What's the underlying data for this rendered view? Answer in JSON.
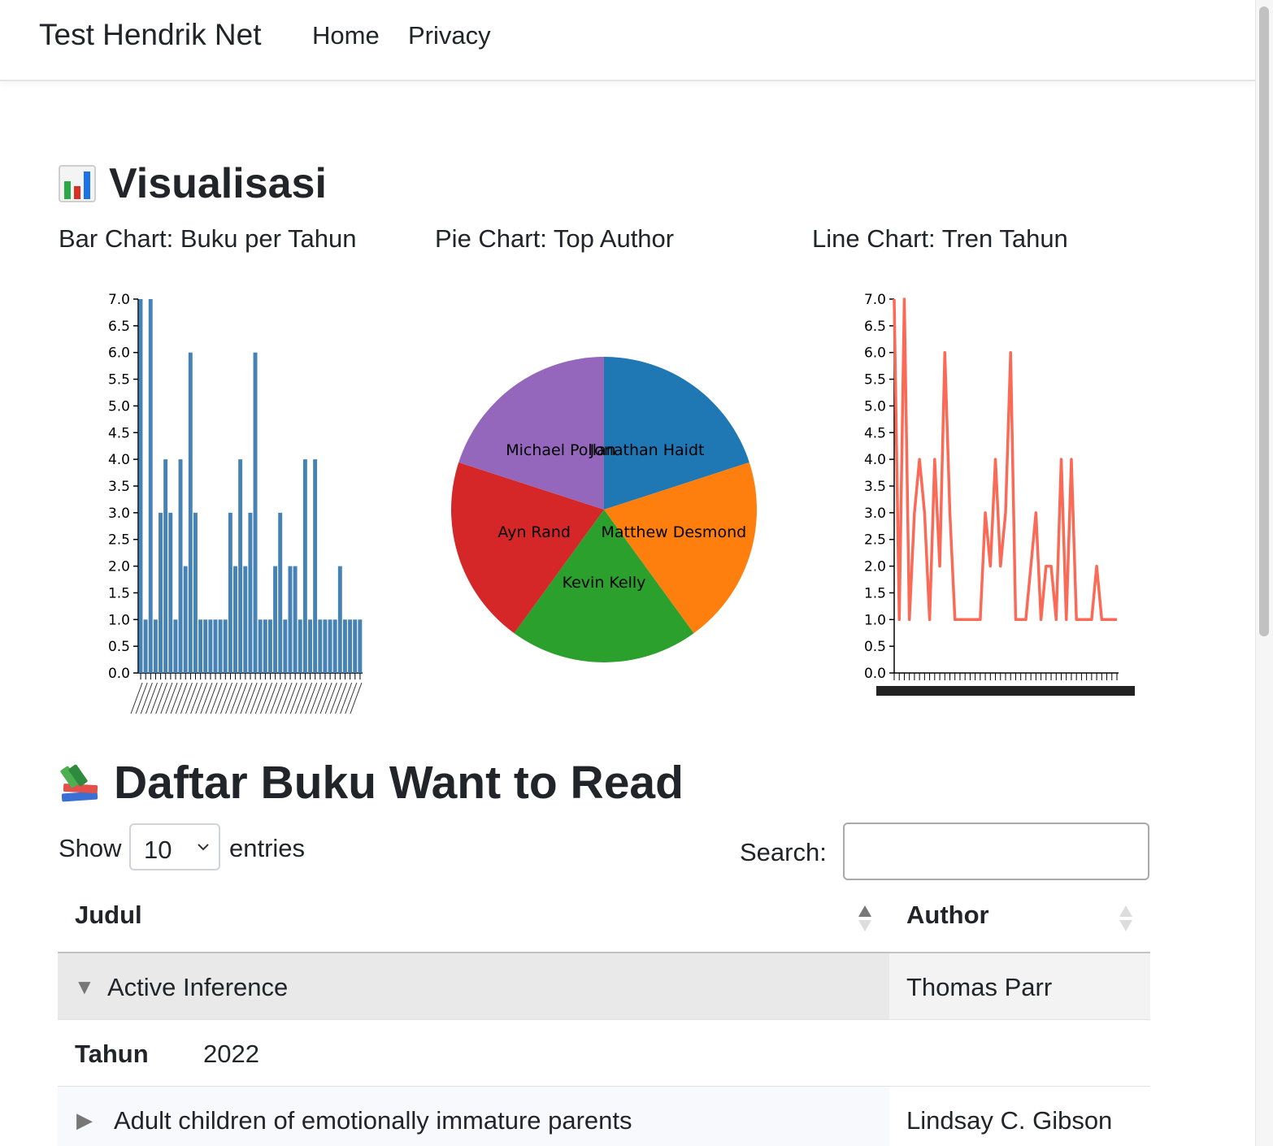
{
  "navbar": {
    "brand": "Test Hendrik Net",
    "links": [
      "Home",
      "Privacy"
    ]
  },
  "visualisasi": {
    "heading_icon": "bar-chart-emoji",
    "heading": "Visualisasi",
    "bar_title": "Bar Chart: Buku per Tahun",
    "pie_title": "Pie Chart: Top Author",
    "line_title": "Line Chart: Tren Tahun"
  },
  "chart_data": [
    {
      "type": "bar",
      "title": "Bar Chart: Buku per Tahun",
      "ylim": [
        0,
        7
      ],
      "y_ticks": [
        "0.0",
        "0.5",
        "1.0",
        "1.5",
        "2.0",
        "2.5",
        "3.0",
        "3.5",
        "4.0",
        "4.5",
        "5.0",
        "5.5",
        "6.0",
        "6.5",
        "7.0"
      ],
      "values": [
        7,
        1,
        7,
        1,
        3,
        4,
        3,
        1,
        4,
        2,
        6,
        3,
        1,
        1,
        1,
        1,
        1,
        1,
        3,
        2,
        4,
        2,
        3,
        6,
        1,
        1,
        1,
        2,
        3,
        1,
        2,
        2,
        1,
        4,
        1,
        4,
        1,
        1,
        1,
        1,
        2,
        1,
        1,
        1,
        1
      ],
      "color": "#4682b4"
    },
    {
      "type": "pie",
      "title": "Pie Chart: Top Author",
      "labels": [
        "Jonathan Haidt",
        "Matthew Desmond",
        "Kevin Kelly",
        "Ayn Rand",
        "Michael Pollan"
      ],
      "values": [
        1,
        1,
        1,
        1,
        1
      ],
      "colors": [
        "#1f77b4",
        "#ff7f0e",
        "#2ca02c",
        "#d62728",
        "#9467bd"
      ]
    },
    {
      "type": "line",
      "title": "Line Chart: Tren Tahun",
      "ylim": [
        0,
        7
      ],
      "y_ticks": [
        "0.0",
        "0.5",
        "1.0",
        "1.5",
        "2.0",
        "2.5",
        "3.0",
        "3.5",
        "4.0",
        "4.5",
        "5.0",
        "5.5",
        "6.0",
        "6.5",
        "7.0"
      ],
      "values": [
        7,
        1,
        7,
        1,
        3,
        4,
        3,
        1,
        4,
        2,
        6,
        3,
        1,
        1,
        1,
        1,
        1,
        1,
        3,
        2,
        4,
        2,
        3,
        6,
        1,
        1,
        1,
        2,
        3,
        1,
        2,
        2,
        1,
        4,
        1,
        4,
        1,
        1,
        1,
        1,
        2,
        1,
        1,
        1,
        1
      ],
      "color": "#fa6a57"
    }
  ],
  "daftar": {
    "heading_icon": "books-emoji",
    "heading": "Daftar Buku Want to Read",
    "show_label": "Show",
    "entries_value": "10",
    "entries_label": "entries",
    "search_label": "Search:",
    "search_value": "",
    "columns": [
      "Judul",
      "Author"
    ],
    "rows": [
      {
        "judul": "Active Inference",
        "author": "Thomas Parr",
        "expanded": true,
        "detail_label": "Tahun",
        "detail_value": "2022"
      },
      {
        "judul": "Adult children of emotionally immature parents",
        "author": "Lindsay C. Gibson",
        "expanded": false
      }
    ]
  }
}
